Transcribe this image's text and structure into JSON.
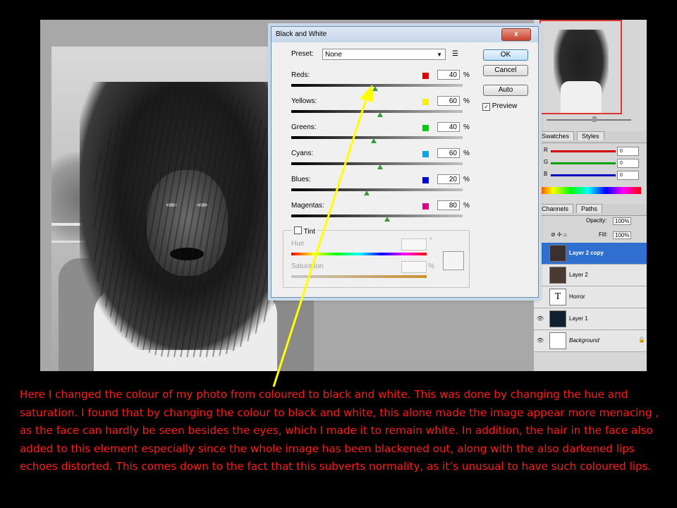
{
  "dialog": {
    "title": "Black and White",
    "close_label": "x",
    "preset_label": "Preset:",
    "preset_value": "None",
    "preset_menu_icon": "list-menu-icon",
    "buttons": {
      "ok": "OK",
      "cancel": "Cancel",
      "auto": "Auto"
    },
    "preview_label": "Preview",
    "preview_checked": true,
    "sliders": [
      {
        "name": "Reds:",
        "value": "40",
        "unit": "%",
        "color": "#e00000",
        "track": "#000000,#c0c0c0",
        "level": 0.49
      },
      {
        "name": "Yellows:",
        "value": "60",
        "unit": "%",
        "color": "#f5f000",
        "track": "#000000,#c0c0c0",
        "level": 0.52
      },
      {
        "name": "Greens:",
        "value": "40",
        "unit": "%",
        "color": "#00d000",
        "track": "#000000,#c0c0c0",
        "level": 0.48
      },
      {
        "name": "Cyans:",
        "value": "60",
        "unit": "%",
        "color": "#00a8e8",
        "track": "#000000,#c0c0c0",
        "level": 0.52
      },
      {
        "name": "Blues:",
        "value": "20",
        "unit": "%",
        "color": "#0000d8",
        "track": "#000000,#c0c0c0",
        "level": 0.44
      },
      {
        "name": "Magentas:",
        "value": "80",
        "unit": "%",
        "color": "#e0008c",
        "track": "#000000,#c0c0c0",
        "level": 0.56
      }
    ],
    "tint": {
      "label": "Tint",
      "checked": false,
      "hue_label": "Hue",
      "hue_unit": "°",
      "saturation_label": "Saturation",
      "saturation_unit": "%"
    }
  },
  "panels": {
    "color_tabs": [
      "Swatches",
      "Styles"
    ],
    "color_rows": [
      {
        "label": "R",
        "value": "0",
        "color": "#d00000"
      },
      {
        "label": "G",
        "value": "0",
        "color": "#00a000"
      },
      {
        "label": "B",
        "value": "0",
        "color": "#0000c0"
      }
    ],
    "layer_tabs": [
      "Channels",
      "Paths"
    ],
    "opacity_label": "Opacity:",
    "opacity_value": "100%",
    "fill_label": "Fill:",
    "fill_value": "100%",
    "layers": [
      {
        "name": "Layer 2 copy",
        "selected": true
      },
      {
        "name": "Layer 2",
        "selected": false
      },
      {
        "name": "Horror",
        "selected": false,
        "type": "T"
      },
      {
        "name": "Layer 1",
        "selected": false
      },
      {
        "name": "Background",
        "selected": false
      }
    ]
  },
  "caption": "Here I changed the colour of my photo from coloured to black and white.  This was done by changing the hue and saturation. I found that by changing the colour to black and white, this alone made the image appear more menacing , as the face can hardly be seen besides the eyes, which I made it to remain white. In addition, the hair in the face also added to this element  especially since the whole image has been blackened out, along with the also darkened lips echoes distorted. This comes down to the fact that this subverts normality, as it’s unusual to have such coloured lips.",
  "annotation_color": "#ffff00",
  "caption_color": "#ff1a1a"
}
